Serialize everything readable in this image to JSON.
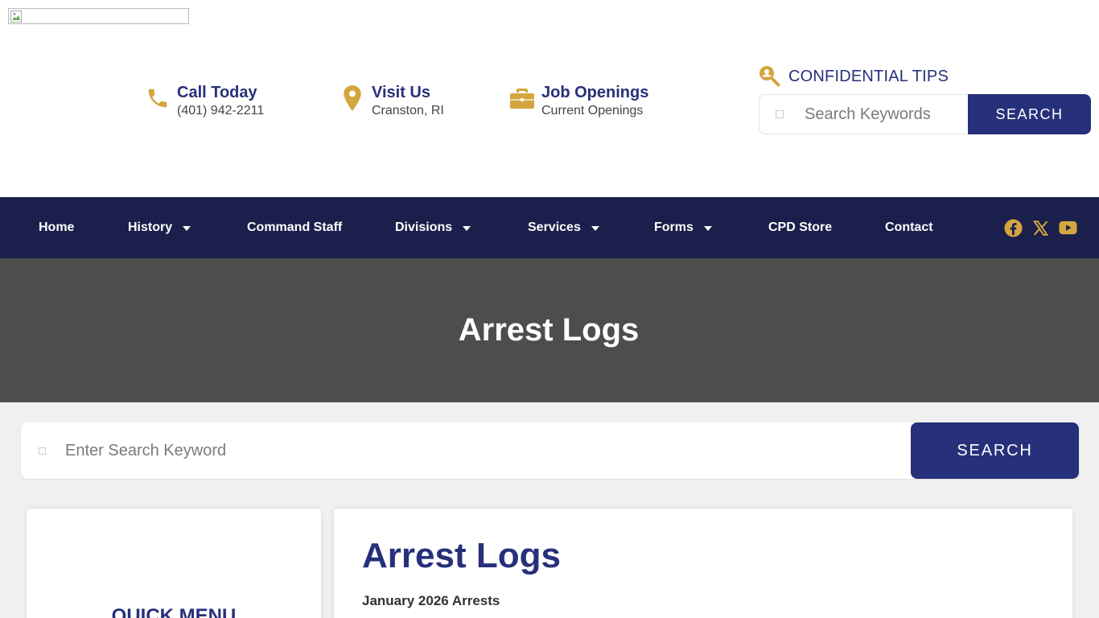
{
  "header": {
    "call": {
      "title": "Call Today",
      "sub": "(401) 942-2211"
    },
    "visit": {
      "title": "Visit Us",
      "sub": "Cranston, RI"
    },
    "jobs": {
      "title": "Job Openings",
      "sub": "Current Openings"
    },
    "tips_label": "CONFIDENTIAL TIPS",
    "search": {
      "placeholder": "Search Keywords",
      "button": "SEARCH"
    }
  },
  "nav": {
    "items": [
      {
        "label": "Home",
        "dropdown": false
      },
      {
        "label": "History",
        "dropdown": true
      },
      {
        "label": "Command Staff",
        "dropdown": false
      },
      {
        "label": "Divisions",
        "dropdown": true
      },
      {
        "label": "Services",
        "dropdown": true
      },
      {
        "label": "Forms",
        "dropdown": true
      },
      {
        "label": "CPD Store",
        "dropdown": false
      },
      {
        "label": "Contact",
        "dropdown": false
      }
    ],
    "social": [
      "facebook-icon",
      "x-twitter-icon",
      "youtube-icon"
    ]
  },
  "hero": {
    "title": "Arrest Logs"
  },
  "main_search": {
    "placeholder": "Enter Search Keyword",
    "button": "SEARCH"
  },
  "sidebar": {
    "heading": "QUICK MENU"
  },
  "content": {
    "title": "Arrest Logs",
    "subtitle": "January 2026 Arrests"
  },
  "colors": {
    "brand_navy": "#27307a",
    "nav_bg": "#1b1f4b",
    "accent_gold": "#d4a63f",
    "hero_bg": "#4d4d4d"
  }
}
